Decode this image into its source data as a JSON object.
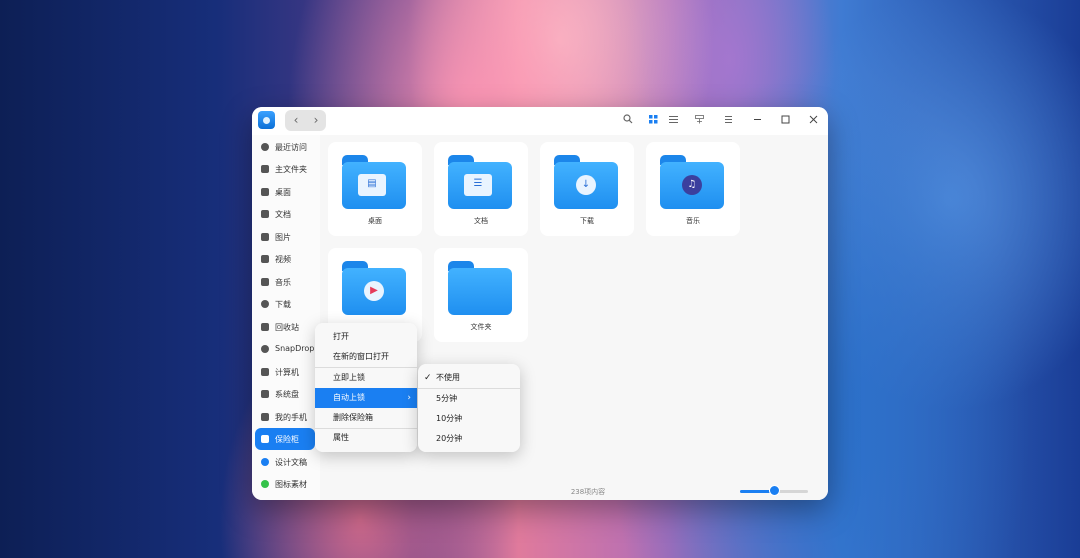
{
  "window": {
    "nav_back": "‹",
    "nav_forward": "›",
    "toolbar_icons": [
      "search-icon",
      "icon-view-icon",
      "list-view-icon",
      "filter-icon",
      "menu-icon",
      "minimize-icon",
      "maximize-icon",
      "close-icon"
    ]
  },
  "sidebar": {
    "items": [
      {
        "label": "最近访问",
        "icon": "clock-icon"
      },
      {
        "label": "主文件夹",
        "icon": "home-icon"
      },
      {
        "label": "桌面",
        "icon": "desktop-icon"
      },
      {
        "label": "文档",
        "icon": "document-icon"
      },
      {
        "label": "图片",
        "icon": "picture-icon"
      },
      {
        "label": "视频",
        "icon": "video-icon"
      },
      {
        "label": "音乐",
        "icon": "music-icon"
      },
      {
        "label": "下载",
        "icon": "download-icon"
      },
      {
        "label": "回收站",
        "icon": "trash-icon"
      },
      {
        "label": "SnapDrop",
        "icon": "snapdrop-icon"
      },
      {
        "label": "计算机",
        "icon": "computer-icon"
      },
      {
        "label": "系统盘",
        "icon": "disk-icon"
      },
      {
        "label": "我的手机",
        "icon": "phone-icon"
      },
      {
        "label": "保险柜",
        "icon": "vault-icon"
      },
      {
        "label": "设计文稿",
        "icon": "tag-blue-icon",
        "color": "#1a7ff2"
      },
      {
        "label": "图标素材",
        "icon": "tag-green-icon",
        "color": "#35c24a"
      }
    ],
    "selected_index": 13
  },
  "files": [
    {
      "label": "桌面",
      "icon": "desktop-folder-icon"
    },
    {
      "label": "文档",
      "icon": "documents-folder-icon"
    },
    {
      "label": "下载",
      "icon": "downloads-folder-icon"
    },
    {
      "label": "音乐",
      "icon": "music-folder-icon"
    },
    {
      "label": "",
      "icon": "videos-folder-icon"
    },
    {
      "label": "文件夹",
      "icon": "folder-icon"
    }
  ],
  "status": {
    "text": "238项内容",
    "zoom_fraction": 0.5
  },
  "context_menu": {
    "items": [
      "打开",
      "在新的窗口打开",
      "立即上锁",
      "自动上锁",
      "删除保险箱",
      "属性"
    ],
    "highlighted_index": 3,
    "submenu_arrow": "›"
  },
  "submenu": {
    "items": [
      "不使用",
      "5分钟",
      "10分钟",
      "20分钟"
    ],
    "checked_index": 0,
    "check_mark": "✓"
  },
  "colors": {
    "accent": "#1a7ff2",
    "folder": "#2f9ff5"
  }
}
